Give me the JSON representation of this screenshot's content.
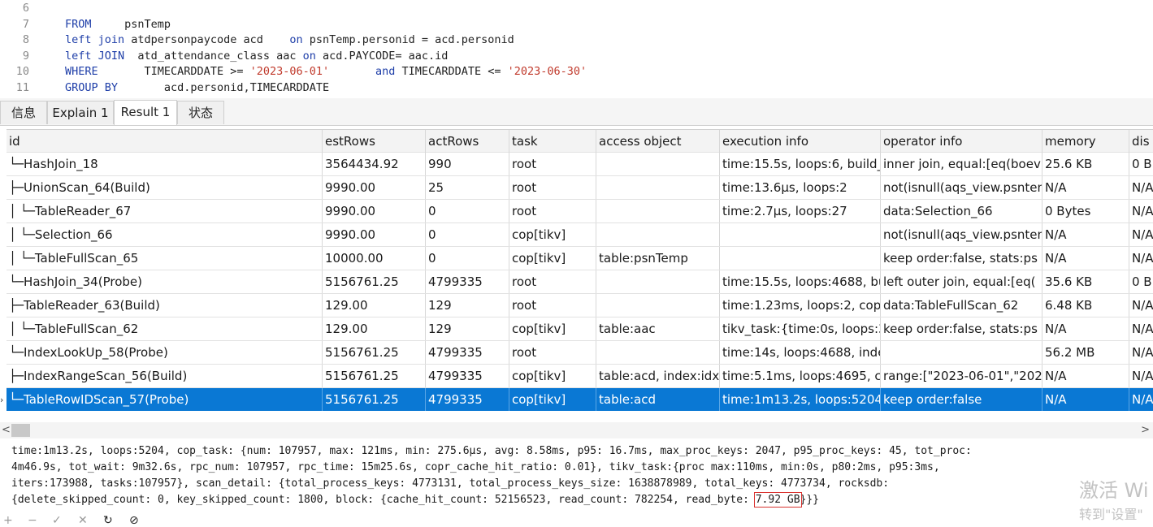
{
  "editor": {
    "lines": [
      {
        "n": "6",
        "parts": []
      },
      {
        "n": "7",
        "parts": [
          {
            "t": "FROM",
            "k": "kw"
          },
          {
            "t": "     psnTemp",
            "k": ""
          }
        ]
      },
      {
        "n": "8",
        "parts": [
          {
            "t": "left join",
            "k": "kw"
          },
          {
            "t": " atdpersonpaycode acd    ",
            "k": ""
          },
          {
            "t": "on",
            "k": "kw"
          },
          {
            "t": " psnTemp.personid = acd.personid",
            "k": ""
          }
        ]
      },
      {
        "n": "9",
        "parts": [
          {
            "t": "left JOIN",
            "k": "kw"
          },
          {
            "t": "  atd_attendance_class aac ",
            "k": ""
          },
          {
            "t": "on",
            "k": "kw"
          },
          {
            "t": " acd.PAYCODE= aac.id",
            "k": ""
          }
        ]
      },
      {
        "n": "10",
        "parts": [
          {
            "t": "WHERE",
            "k": "kw"
          },
          {
            "t": "       TIMECARDDATE >= ",
            "k": ""
          },
          {
            "t": "'2023-06-01'",
            "k": "str"
          },
          {
            "t": "       ",
            "k": ""
          },
          {
            "t": "and",
            "k": "kw"
          },
          {
            "t": " TIMECARDDATE <= ",
            "k": ""
          },
          {
            "t": "'2023-06-30'",
            "k": "str"
          }
        ]
      },
      {
        "n": "11",
        "parts": [
          {
            "t": "GROUP BY",
            "k": "kw"
          },
          {
            "t": "       acd.personid,TIMECARDDATE",
            "k": ""
          }
        ]
      }
    ]
  },
  "tabs": [
    {
      "label": "信息",
      "active": false
    },
    {
      "label": "Explain 1",
      "active": false
    },
    {
      "label": "Result 1",
      "active": true
    },
    {
      "label": "状态",
      "active": false
    }
  ],
  "grid": {
    "columns": [
      "id",
      "estRows",
      "actRows",
      "task",
      "access object",
      "execution info",
      "operator info",
      "memory",
      "dis"
    ],
    "rows": [
      [
        "    └─HashJoin_18",
        "3564434.92",
        "990",
        "root",
        "",
        "time:15.5s, loops:6, build_",
        "inner join, equal:[eq(boev",
        "25.6 KB",
        "0 B"
      ],
      [
        "     ├─UnionScan_64(Build)",
        "9990.00",
        "25",
        "root",
        "",
        "time:13.6µs, loops:2",
        "not(isnull(aqs_view.psnten",
        "N/A",
        "N/A"
      ],
      [
        "     │ └─TableReader_67",
        "9990.00",
        "0",
        "root",
        "",
        "time:2.7µs, loops:27",
        "data:Selection_66",
        "0 Bytes",
        "N/A"
      ],
      [
        "     │   └─Selection_66",
        "9990.00",
        "0",
        "cop[tikv]",
        "",
        "",
        "not(isnull(aqs_view.psnten",
        "N/A",
        "N/A"
      ],
      [
        "     │     └─TableFullScan_65",
        "10000.00",
        "0",
        "cop[tikv]",
        "table:psnTemp",
        "",
        "keep order:false, stats:ps",
        "N/A",
        "N/A"
      ],
      [
        "     └─HashJoin_34(Probe)",
        "5156761.25",
        "4799335",
        "root",
        "",
        "time:15.5s, loops:4688, bu",
        "left outer join, equal:[eq(",
        "35.6 KB",
        "0 B"
      ],
      [
        "       ├─TableReader_63(Build)",
        "129.00",
        "129",
        "root",
        "",
        "time:1.23ms, loops:2, cop",
        "data:TableFullScan_62",
        "6.48 KB",
        "N/A"
      ],
      [
        "       │ └─TableFullScan_62",
        "129.00",
        "129",
        "cop[tikv]",
        "table:aac",
        "tikv_task:{time:0s, loops:3",
        "keep order:false, stats:ps",
        "N/A",
        "N/A"
      ],
      [
        "       └─IndexLookUp_58(Probe)",
        "5156761.25",
        "4799335",
        "root",
        "",
        "time:14s, loops:4688, inde",
        "",
        "56.2 MB",
        "N/A"
      ],
      [
        "         ├─IndexRangeScan_56(Build)",
        "5156761.25",
        "4799335",
        "cop[tikv]",
        "table:acd, index:idx",
        "time:5.1ms, loops:4695, c",
        "range:[\"2023-06-01\",\"202",
        "N/A",
        "N/A"
      ],
      [
        "         └─TableRowIDScan_57(Probe)",
        "5156761.25",
        "4799335",
        "cop[tikv]",
        "table:acd",
        "time:1m13.2s, loops:5204,",
        "keep order:false",
        "N/A",
        "N/A"
      ]
    ],
    "selected_index": 10,
    "row_marker": "›"
  },
  "scrollbar": {
    "left_arrow": "<",
    "right_arrow": ">"
  },
  "detail": {
    "line1": "time:1m13.2s, loops:5204, cop_task: {num: 107957, max: 121ms, min: 275.6µs, avg: 8.58ms, p95: 16.7ms, max_proc_keys: 2047, p95_proc_keys: 45, tot_proc:",
    "line2": "4m46.9s, tot_wait: 9m32.6s, rpc_num: 107957, rpc_time: 15m25.6s, copr_cache_hit_ratio: 0.01}, tikv_task:{proc max:110ms, min:0s, p80:2ms, p95:3ms,",
    "line3": "iters:173988, tasks:107957}, scan_detail: {total_process_keys: 4773131, total_process_keys_size: 1638878989, total_keys: 4773734, rocksdb:",
    "line4_pre": "{delete_skipped_count: 0, key_skipped_count: 1800, block: {cache_hit_count: 52156523, read_count: 782254, read_byte: ",
    "line4_hl": "7.92 GB",
    "line4_post": "}}}"
  },
  "watermark": {
    "line1": "激活 Wi",
    "line2": "转到\"设置\""
  },
  "toolbar": {
    "add": "+",
    "remove": "−",
    "apply": "✓",
    "discard": "✕",
    "refresh": "↻",
    "stop": "⊘"
  }
}
